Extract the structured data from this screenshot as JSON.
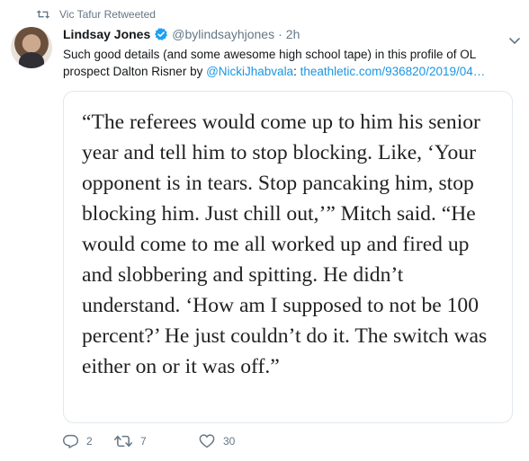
{
  "retweet_context": {
    "icon": "retweet-icon",
    "text": "Vic Tafur Retweeted"
  },
  "tweet": {
    "author": {
      "display_name": "Lindsay Jones",
      "verified_icon": "verified-badge-icon",
      "handle": "@bylindsayhjones",
      "separator": "·",
      "time": "2h"
    },
    "text_before": "Such good details (and some awesome high school tape) in this profile of OL prospect Dalton Risner by ",
    "mention": "@NickiJhabvala",
    "text_middle": ": ",
    "url": "theathletic.com/936820/2019/04…",
    "quote_image_text": "“The referees would come up to him his senior year and tell him to stop blocking. Like, ‘Your opponent is in tears. Stop pancaking him, stop blocking him. Just chill out,’” Mitch said. “He would come to me all worked up and fired up and slobbering and spitting. He didn’t understand. ‘How am I supposed to not be 100 percent?’ He just couldn’t do it. The switch was either on or it was off.”",
    "actions": {
      "reply_count": "2",
      "retweet_count": "7",
      "like_count": "30"
    }
  },
  "colors": {
    "link": "#1b95e0",
    "muted": "#657786",
    "border": "#e1e8ed",
    "verified": "#1da1f2"
  }
}
